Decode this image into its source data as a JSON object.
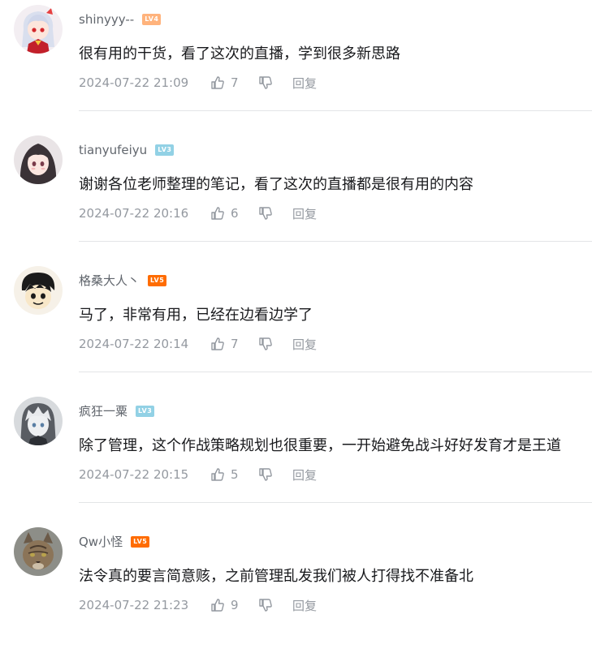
{
  "comments": [
    {
      "username": "shinyyy--",
      "level": "LV4",
      "level_color": "#ffb37c",
      "content": "很有用的干货，看了这次的直播，学到很多新思路",
      "time": "2024-07-22 21:09",
      "likes": "7",
      "reply_label": "回复",
      "avatar_icon": "anime-girl-avatar"
    },
    {
      "username": "tianyufeiyu",
      "level": "LV3",
      "level_color": "#92d1e5",
      "content": "谢谢各位老师整理的笔记，看了这次的直播都是很有用的内容",
      "time": "2024-07-22 20:16",
      "likes": "6",
      "reply_label": "回复",
      "avatar_icon": "dark-hair-girl-avatar"
    },
    {
      "username": "格桑大人丶",
      "level": "LV5",
      "level_color": "#ff6c00",
      "content": "马了，非常有用，已经在边看边学了",
      "time": "2024-07-22 20:14",
      "likes": "7",
      "reply_label": "回复",
      "avatar_icon": "cartoon-boy-avatar"
    },
    {
      "username": "疯狂一粟",
      "level": "LV3",
      "level_color": "#92d1e5",
      "content": "除了管理，这个作战策略规划也很重要，一开始避免战斗好好发育才是王道",
      "time": "2024-07-22 20:15",
      "likes": "5",
      "reply_label": "回复",
      "avatar_icon": "white-hair-boy-avatar"
    },
    {
      "username": "Qw小怪",
      "level": "LV5",
      "level_color": "#ff6c00",
      "content": "法令真的要言简意赅，之前管理乱发我们被人打得找不准备北",
      "time": "2024-07-22 21:23",
      "likes": "9",
      "reply_label": "回复",
      "avatar_icon": "cat-avatar"
    }
  ],
  "icons": {
    "like": "thumbs-up-icon",
    "dislike": "thumbs-down-icon"
  }
}
